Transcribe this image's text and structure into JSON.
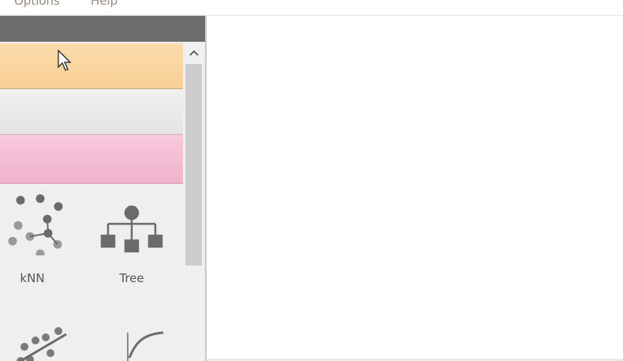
{
  "menu": {
    "items": [
      "Options",
      "Help"
    ]
  },
  "widgets": [
    {
      "label": "kNN",
      "icon": "knn-icon"
    },
    {
      "label": "Tree",
      "icon": "tree-icon"
    },
    {
      "label": "",
      "icon": "linear-regression-icon"
    },
    {
      "label": "",
      "icon": "logistic-regression-icon"
    }
  ],
  "scrollbar": {
    "up_arrow": "︿"
  },
  "colors": {
    "category_orange": "#fbdcaa",
    "category_pink": "#f8c9dc",
    "dock_title": "#6e6e6e"
  }
}
